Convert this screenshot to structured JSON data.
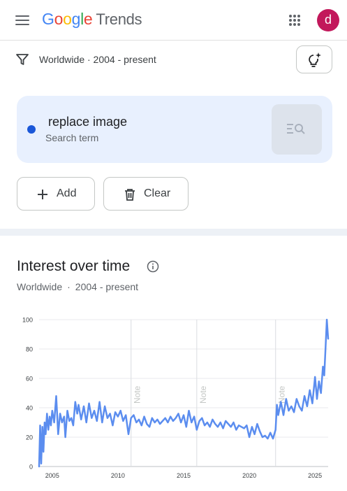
{
  "header": {
    "logo_parts": [
      "G",
      "o",
      "o",
      "g",
      "l",
      "e"
    ],
    "logo_suffix": "Trends",
    "avatar_letter": "d",
    "menu_icon": "hamburger-menu-icon",
    "apps_icon": "apps-grid-icon"
  },
  "filters": {
    "text": "Worldwide · 2004 - present",
    "filter_icon": "filter-funnel-icon",
    "assist_icon": "lightbulb-sparkle-icon"
  },
  "term": {
    "name": "replace image",
    "type": "Search term",
    "color": "#1a57d8",
    "explore_icon": "search-list-icon"
  },
  "actions": {
    "add_label": "Add",
    "clear_label": "Clear"
  },
  "section": {
    "title": "Interest over time",
    "region": "Worldwide",
    "separator": "·",
    "period": "2004 - present"
  },
  "colors": {
    "line": "#5b8def",
    "term_dot": "#1a57d8",
    "avatar": "#c2185b",
    "card_bg": "#e8f0fe"
  },
  "chart_data": {
    "type": "line",
    "title": "Interest over time",
    "xlabel": "",
    "ylabel": "",
    "ylim": [
      0,
      100
    ],
    "xlim": [
      2004,
      2026
    ],
    "y_ticks": [
      "0",
      "20",
      "40",
      "60",
      "80",
      "100"
    ],
    "x_ticks": [
      "2005",
      "2010",
      "2015",
      "2020",
      "2025"
    ],
    "grid": true,
    "annotations": [
      {
        "x": 2011,
        "label": "Note"
      },
      {
        "x": 2016,
        "label": "Note"
      },
      {
        "x": 2022,
        "label": "Note"
      }
    ],
    "series": [
      {
        "x": [
          2004.0,
          2004.08,
          2004.16,
          2004.25,
          2004.33,
          2004.42,
          2004.5,
          2004.6,
          2004.7,
          2004.8,
          2004.9,
          2005.0,
          2005.15,
          2005.3,
          2005.45,
          2005.6,
          2005.75,
          2005.9,
          2006.0,
          2006.15,
          2006.3,
          2006.45,
          2006.6,
          2006.75,
          2006.9,
          2007.0,
          2007.2,
          2007.4,
          2007.6,
          2007.8,
          2008.0,
          2008.2,
          2008.4,
          2008.6,
          2008.8,
          2009.0,
          2009.2,
          2009.4,
          2009.6,
          2009.8,
          2010.0,
          2010.2,
          2010.4,
          2010.6,
          2010.8,
          2011.0,
          2011.2,
          2011.4,
          2011.6,
          2011.8,
          2012.0,
          2012.2,
          2012.4,
          2012.6,
          2012.8,
          2013.0,
          2013.2,
          2013.4,
          2013.6,
          2013.8,
          2014.0,
          2014.2,
          2014.4,
          2014.6,
          2014.8,
          2015.0,
          2015.2,
          2015.4,
          2015.6,
          2015.8,
          2016.0,
          2016.2,
          2016.4,
          2016.6,
          2016.8,
          2017.0,
          2017.2,
          2017.4,
          2017.6,
          2017.8,
          2018.0,
          2018.2,
          2018.4,
          2018.6,
          2018.8,
          2019.0,
          2019.2,
          2019.4,
          2019.6,
          2019.8,
          2020.0,
          2020.2,
          2020.4,
          2020.6,
          2020.8,
          2021.0,
          2021.2,
          2021.4,
          2021.6,
          2021.8,
          2022.0,
          2022.1,
          2022.2,
          2022.4,
          2022.6,
          2022.8,
          2023.0,
          2023.2,
          2023.4,
          2023.6,
          2023.8,
          2024.0,
          2024.2,
          2024.4,
          2024.6,
          2024.8,
          2025.0,
          2025.15,
          2025.3,
          2025.45,
          2025.6,
          2025.7,
          2025.8,
          2025.9,
          2026.0
        ],
        "values": [
          0,
          28,
          2,
          27,
          10,
          30,
          22,
          36,
          25,
          34,
          28,
          38,
          30,
          48,
          22,
          36,
          30,
          34,
          20,
          38,
          31,
          33,
          28,
          44,
          36,
          42,
          32,
          41,
          30,
          43,
          33,
          38,
          31,
          44,
          30,
          41,
          33,
          36,
          28,
          37,
          34,
          38,
          31,
          35,
          22,
          33,
          35,
          30,
          32,
          28,
          34,
          29,
          27,
          33,
          30,
          32,
          29,
          31,
          33,
          30,
          34,
          31,
          33,
          36,
          30,
          35,
          27,
          38,
          30,
          34,
          25,
          31,
          33,
          28,
          30,
          27,
          32,
          29,
          27,
          30,
          26,
          31,
          29,
          27,
          30,
          25,
          28,
          27,
          26,
          28,
          20,
          27,
          22,
          29,
          24,
          20,
          21,
          19,
          23,
          19,
          25,
          42,
          35,
          44,
          35,
          46,
          38,
          41,
          37,
          46,
          41,
          38,
          48,
          41,
          52,
          43,
          61,
          46,
          58,
          50,
          68,
          62,
          80,
          100,
          87
        ]
      }
    ]
  }
}
